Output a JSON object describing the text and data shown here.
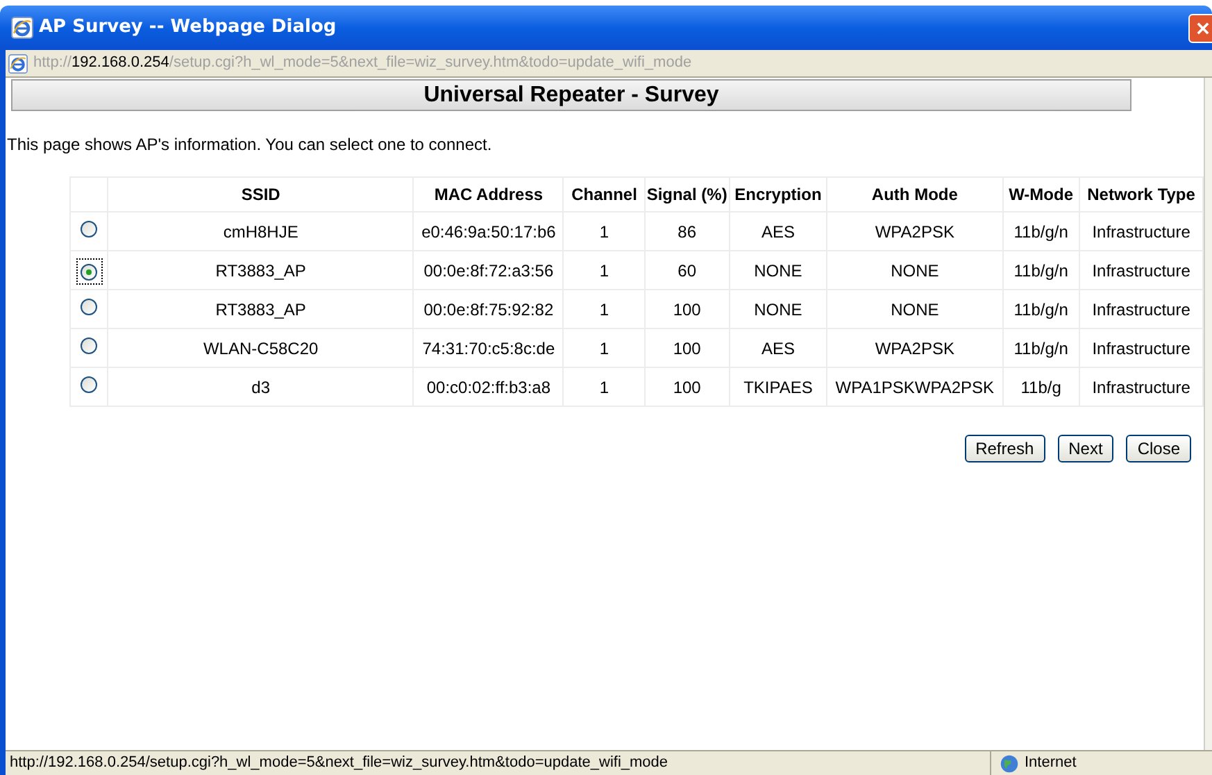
{
  "window": {
    "title": "AP Survey -- Webpage Dialog"
  },
  "address_bar": {
    "scheme": "http://",
    "host": "192.168.0.254",
    "path": "/setup.cgi?h_wl_mode=5&next_file=wiz_survey.htm&todo=update_wifi_mode"
  },
  "page": {
    "heading": "Universal Repeater - Survey",
    "intro": "This page shows AP's information. You can select one to connect."
  },
  "table": {
    "columns": [
      "SSID",
      "MAC Address",
      "Channel",
      "Signal (%)",
      "Encryption",
      "Auth Mode",
      "W-Mode",
      "Network Type"
    ],
    "rows": [
      {
        "selected": false,
        "cells": [
          "cmH8HJE",
          "e0:46:9a:50:17:b6",
          "1",
          "86",
          "AES",
          "WPA2PSK",
          "11b/g/n",
          "Infrastructure"
        ]
      },
      {
        "selected": true,
        "cells": [
          "RT3883_AP",
          "00:0e:8f:72:a3:56",
          "1",
          "60",
          "NONE",
          "NONE",
          "11b/g/n",
          "Infrastructure"
        ]
      },
      {
        "selected": false,
        "cells": [
          "RT3883_AP",
          "00:0e:8f:75:92:82",
          "1",
          "100",
          "NONE",
          "NONE",
          "11b/g/n",
          "Infrastructure"
        ]
      },
      {
        "selected": false,
        "cells": [
          "WLAN-C58C20",
          "74:31:70:c5:8c:de",
          "1",
          "100",
          "AES",
          "WPA2PSK",
          "11b/g/n",
          "Infrastructure"
        ]
      },
      {
        "selected": false,
        "cells": [
          "d3",
          "00:c0:02:ff:b3:a8",
          "1",
          "100",
          "TKIPAES",
          "WPA1PSKWPA2PSK",
          "11b/g",
          "Infrastructure"
        ]
      }
    ]
  },
  "buttons": [
    "Refresh",
    "Next",
    "Close"
  ],
  "status_bar": {
    "text": "http://192.168.0.254/setup.cgi?h_wl_mode=5&next_file=wiz_survey.htm&todo=update_wifi_mode",
    "zone": "Internet"
  }
}
